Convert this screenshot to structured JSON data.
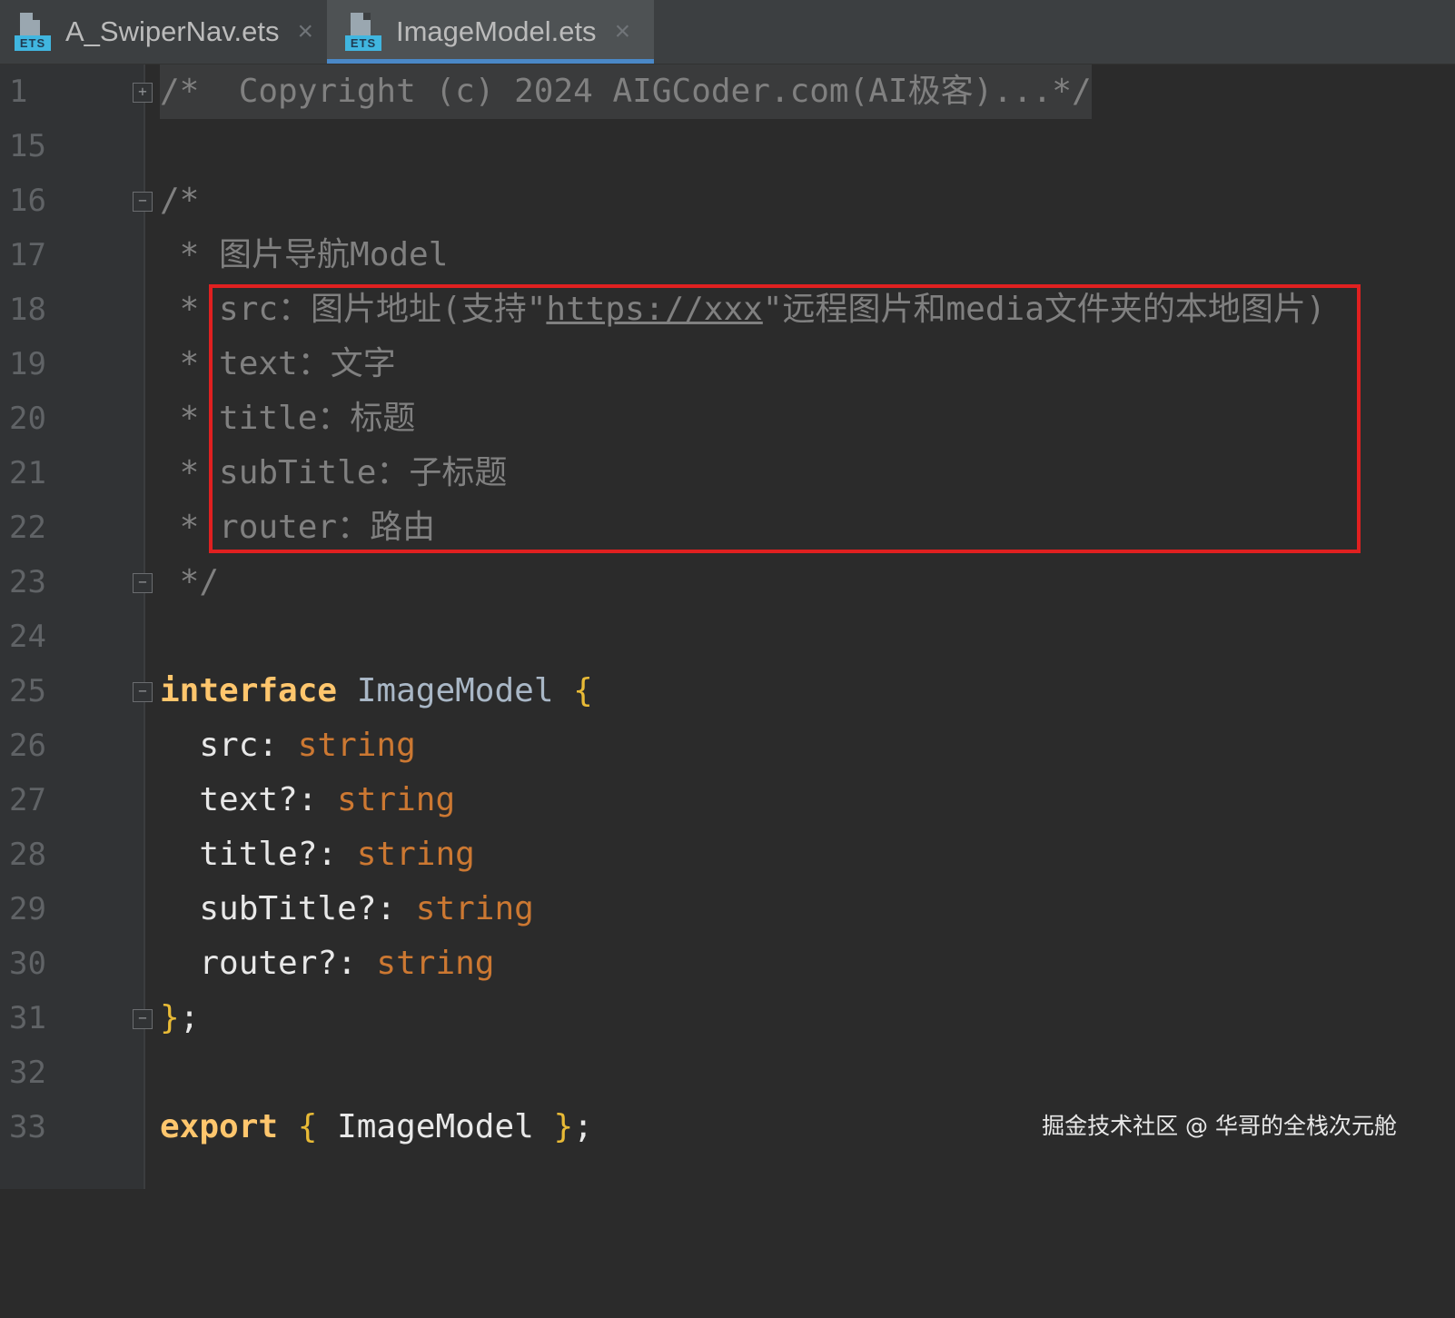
{
  "tabs": [
    {
      "label": "A_SwiperNav.ets",
      "icon": "ets-file-icon",
      "icon_text": "ETS",
      "active": false
    },
    {
      "label": "ImageModel.ets",
      "icon": "ets-file-icon",
      "icon_text": "ETS",
      "active": true
    }
  ],
  "close_glyph": "×",
  "colors": {
    "comment": "#808080",
    "keyword": "#cc7832",
    "highlight_box": "#e02020",
    "tab_underline": "#4a88c7"
  },
  "lines": {
    "l1": {
      "num": "1",
      "text": "/*  Copyright (c) 2024 AIGCoder.com(AI极客)...*/"
    },
    "l15": {
      "num": "15"
    },
    "l16": {
      "num": "16",
      "text": "/*"
    },
    "l17": {
      "num": "17",
      "text": " * 图片导航Model"
    },
    "l18": {
      "num": "18",
      "prefix": " * src：图片地址(支持\"",
      "link": "https://xxx",
      "suffix": "\"远程图片和media文件夹的本地图片)"
    },
    "l19": {
      "num": "19",
      "text": " * text：文字"
    },
    "l20": {
      "num": "20",
      "text": " * title：标题"
    },
    "l21": {
      "num": "21",
      "text": " * subTitle：子标题"
    },
    "l22": {
      "num": "22",
      "text": " * router：路由"
    },
    "l23": {
      "num": "23",
      "text": " */"
    },
    "l24": {
      "num": "24"
    },
    "l25": {
      "num": "25",
      "kw": "interface",
      "name": " ImageModel ",
      "brace": "{"
    },
    "l26": {
      "num": "26",
      "prop": "  src: ",
      "type": "string"
    },
    "l27": {
      "num": "27",
      "prop": "  text?: ",
      "type": "string"
    },
    "l28": {
      "num": "28",
      "prop": "  title?: ",
      "type": "string"
    },
    "l29": {
      "num": "29",
      "prop": "  subTitle?: ",
      "type": "string"
    },
    "l30": {
      "num": "30",
      "prop": "  router?: ",
      "type": "string"
    },
    "l31": {
      "num": "31",
      "brace": "}",
      "semi": ";"
    },
    "l32": {
      "num": "32"
    },
    "l33": {
      "num": "33",
      "kw": "export",
      "open": " { ",
      "name": "ImageModel",
      "close": " }",
      "semi": ";"
    }
  },
  "watermark": "掘金技术社区 @ 华哥的全栈次元舱"
}
